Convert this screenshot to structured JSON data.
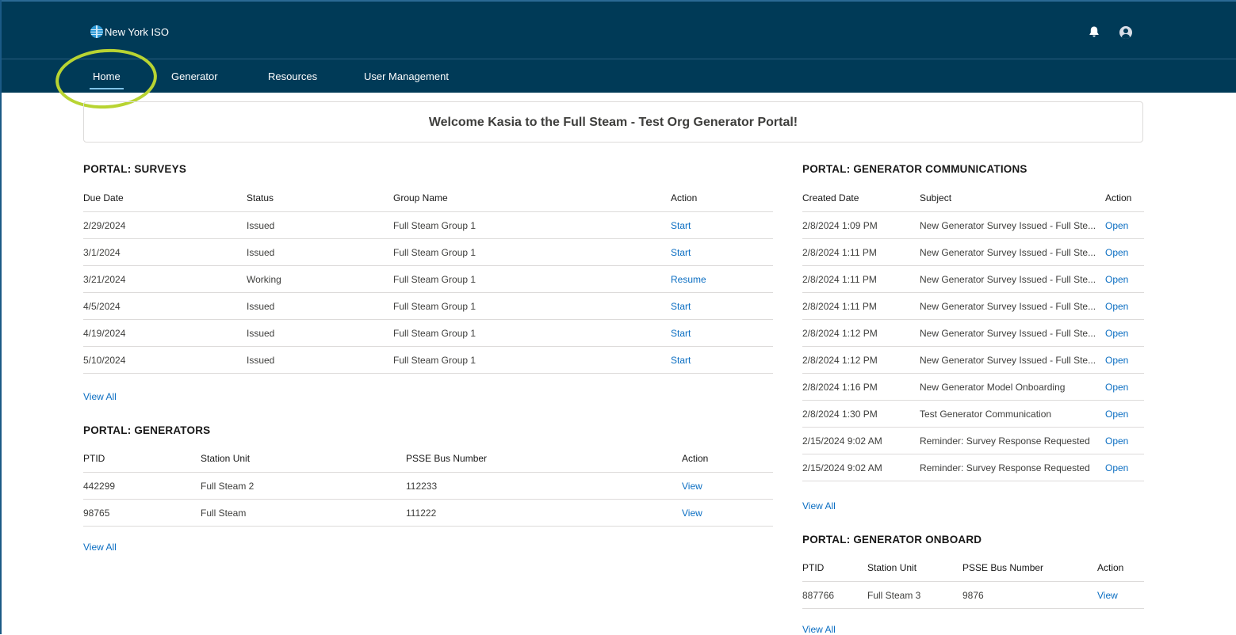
{
  "app": {
    "logo_text": "New York ISO"
  },
  "nav": {
    "items": [
      {
        "label": "Home"
      },
      {
        "label": "Generator"
      },
      {
        "label": "Resources"
      },
      {
        "label": "User Management"
      }
    ]
  },
  "welcome": "Welcome Kasia to the Full Steam - Test Org Generator Portal!",
  "surveys": {
    "title": "PORTAL: SURVEYS",
    "columns": [
      "Due Date",
      "Status",
      "Group Name",
      "Action"
    ],
    "rows": [
      [
        "2/29/2024",
        "Issued",
        "Full Steam Group 1",
        "Start"
      ],
      [
        "3/1/2024",
        "Issued",
        "Full Steam Group 1",
        "Start"
      ],
      [
        "3/21/2024",
        "Working",
        "Full Steam Group 1",
        "Resume"
      ],
      [
        "4/5/2024",
        "Issued",
        "Full Steam Group 1",
        "Start"
      ],
      [
        "4/19/2024",
        "Issued",
        "Full Steam Group 1",
        "Start"
      ],
      [
        "5/10/2024",
        "Issued",
        "Full Steam Group 1",
        "Start"
      ]
    ],
    "view_all": "View All"
  },
  "generators": {
    "title": "PORTAL: GENERATORS",
    "columns": [
      "PTID",
      "Station Unit",
      "PSSE Bus Number",
      "Action"
    ],
    "rows": [
      [
        "442299",
        "Full Steam 2",
        "112233",
        "View"
      ],
      [
        "98765",
        "Full Steam",
        "111222",
        "View"
      ]
    ],
    "view_all": "View All"
  },
  "communications": {
    "title": "PORTAL: GENERATOR COMMUNICATIONS",
    "columns": [
      "Created Date",
      "Subject",
      "Action"
    ],
    "rows": [
      [
        "2/8/2024 1:09 PM",
        "New Generator Survey Issued - Full Ste...",
        "Open"
      ],
      [
        "2/8/2024 1:11 PM",
        "New Generator Survey Issued - Full Ste...",
        "Open"
      ],
      [
        "2/8/2024 1:11 PM",
        "New Generator Survey Issued - Full Ste...",
        "Open"
      ],
      [
        "2/8/2024 1:11 PM",
        "New Generator Survey Issued - Full Ste...",
        "Open"
      ],
      [
        "2/8/2024 1:12 PM",
        "New Generator Survey Issued - Full Ste...",
        "Open"
      ],
      [
        "2/8/2024 1:12 PM",
        "New Generator Survey Issued - Full Ste...",
        "Open"
      ],
      [
        "2/8/2024 1:16 PM",
        "New Generator Model Onboarding",
        "Open"
      ],
      [
        "2/8/2024 1:30 PM",
        "Test Generator Communication",
        "Open"
      ],
      [
        "2/15/2024 9:02 AM",
        "Reminder: Survey Response Requested",
        "Open"
      ],
      [
        "2/15/2024 9:02 AM",
        "Reminder: Survey Response Requested",
        "Open"
      ]
    ],
    "view_all": "View All"
  },
  "onboard": {
    "title": "PORTAL: GENERATOR ONBOARD",
    "columns": [
      "PTID",
      "Station Unit",
      "PSSE Bus Number",
      "Action"
    ],
    "rows": [
      [
        "887766",
        "Full Steam 3",
        "9876",
        "View"
      ]
    ],
    "view_all": "View All"
  },
  "icons": {
    "notifications": "bell-icon",
    "user": "user-avatar-icon",
    "logo": "globe-icon"
  },
  "colors": {
    "header_bg": "#003a57",
    "link": "#0b6ec2",
    "highlight": "#b8d432"
  }
}
